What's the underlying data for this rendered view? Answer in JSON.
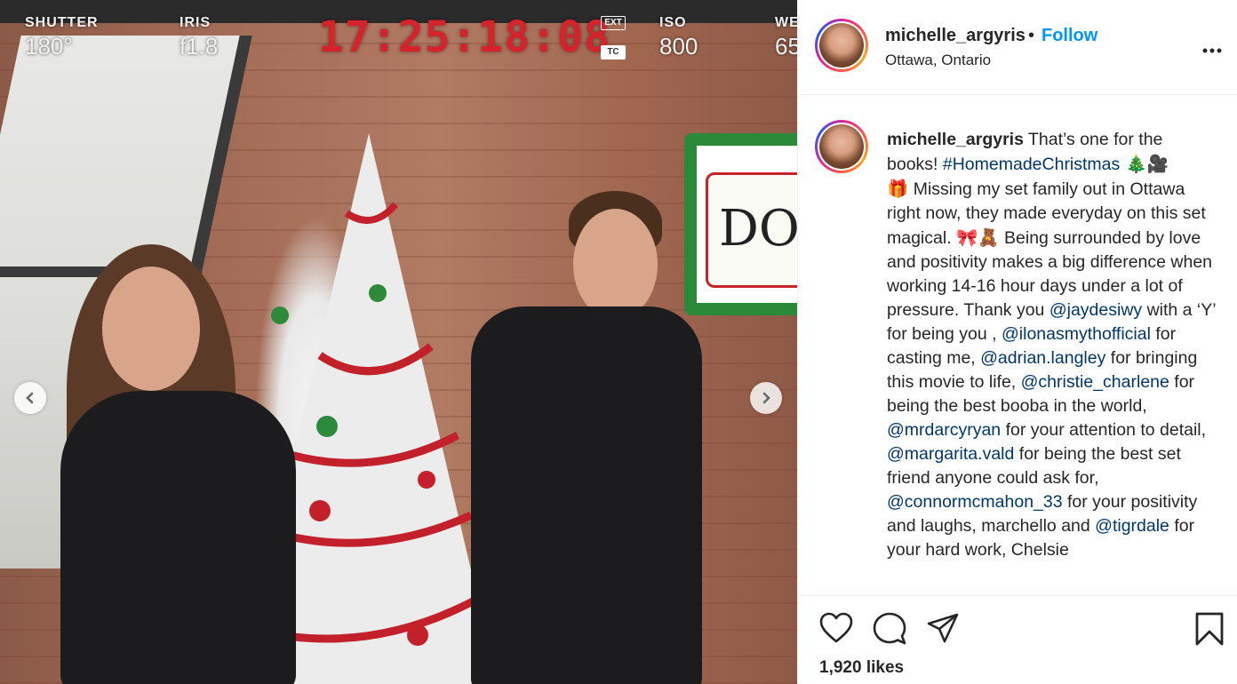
{
  "camera_hud": {
    "shutter_label": "SHUTTER",
    "shutter_value": "180°",
    "iris_label": "IRIS",
    "iris_value": "f1.8",
    "timecode": "17:25:18:08",
    "ext_tag": "EXT",
    "tc_tag": "TC",
    "iso_label": "ISO",
    "iso_value": "800",
    "wb_label": "WE",
    "wb_value": "65"
  },
  "photo": {
    "sign_text": "DON"
  },
  "post": {
    "username": "michelle_argyris",
    "separator": "•",
    "follow_label": "Follow",
    "location": "Ottawa, Ontario",
    "more_label": "•••"
  },
  "caption": {
    "username": "michelle_argyris",
    "t1": " That’s one for the books! ",
    "hashtag": "#HomemadeChristmas",
    "e1": " 🎄🎥",
    "e2": "🎁",
    "t2": " Missing my set family out in Ottawa right now, they made everyday on this set magical. ",
    "e3": "🎀🧸",
    "t3": " Being surrounded by love and positivity makes a big difference when working 14-16 hour days under a lot of pressure. Thank you ",
    "m1": "@jaydesiwy",
    "t4": " with a ‘Y’ for being you , ",
    "m2": "@ilonasmythofficial",
    "t5": " for casting me, ",
    "m3": "@adrian.langley",
    "t6": " for bringing this movie to life, ",
    "m4": "@christie_charlene",
    "t7": " for being the best booba in the world, ",
    "m5": "@mrdarcyryan",
    "t8": " for your attention to detail, ",
    "m6": "@margarita.vald",
    "t9": " for being the best set friend anyone could ask for, ",
    "m7": "@connormcmahon_33",
    "t10": " for your positivity and laughs, marchello and ",
    "m8": "@tigrdale",
    "t11": " for your hard work, Chelsie"
  },
  "actions": {
    "likes": "1,920 likes"
  },
  "icons": {
    "prev": "chevron-left-icon",
    "next": "chevron-right-icon",
    "like": "heart-icon",
    "comment": "comment-icon",
    "share": "paper-plane-icon",
    "save": "bookmark-icon"
  },
  "colors": {
    "follow_blue": "#0095f6",
    "mention_blue": "#00376b",
    "timecode_red": "#d6232b"
  }
}
